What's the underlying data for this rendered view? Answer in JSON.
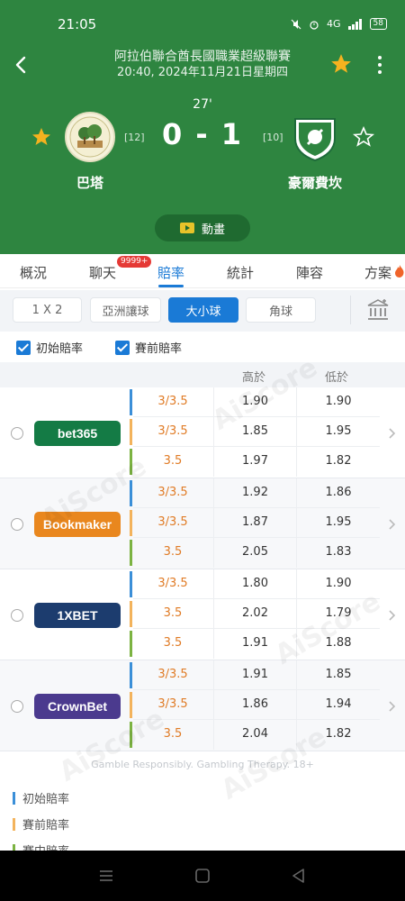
{
  "status_bar": {
    "time": "21:05",
    "network": "4G",
    "battery": "58"
  },
  "header": {
    "league": "阿拉伯聯合酋長國職業超級聯賽",
    "datetime": "20:40, 2024年11月21日星期四",
    "minute": "27'",
    "score": "0 - 1",
    "home": {
      "name": "巴塔",
      "rank": "[12]"
    },
    "away": {
      "name": "豪爾費坎",
      "rank": "[10]"
    },
    "animation_label": "動畫"
  },
  "tabs": [
    {
      "label": "概況"
    },
    {
      "label": "聊天"
    },
    {
      "label": "賠率"
    },
    {
      "label": "統計"
    },
    {
      "label": "陣容"
    },
    {
      "label": "方案"
    }
  ],
  "chat_badge": "9999+",
  "markets": [
    {
      "label": "1 X 2"
    },
    {
      "label": "亞洲讓球"
    },
    {
      "label": "大小球"
    },
    {
      "label": "角球"
    }
  ],
  "checkboxes": [
    {
      "label": "初始賠率"
    },
    {
      "label": "賽前賠率"
    }
  ],
  "table": {
    "headers": {
      "over": "高於",
      "under": "低於"
    },
    "bookmakers": [
      {
        "name": "bet365",
        "color": "#147b45",
        "rows": [
          {
            "line": "3/3.5",
            "over": "1.90",
            "under": "1.90"
          },
          {
            "line": "3/3.5",
            "over": "1.85",
            "under": "1.95"
          },
          {
            "line": "3.5",
            "over": "1.97",
            "under": "1.82"
          }
        ]
      },
      {
        "name": "Bookmaker",
        "color": "#e9871e",
        "rows": [
          {
            "line": "3/3.5",
            "over": "1.92",
            "under": "1.86"
          },
          {
            "line": "3/3.5",
            "over": "1.87",
            "under": "1.95"
          },
          {
            "line": "3.5",
            "over": "2.05",
            "under": "1.83"
          }
        ]
      },
      {
        "name": "1XBET",
        "color": "#1c3c6e",
        "rows": [
          {
            "line": "3/3.5",
            "over": "1.80",
            "under": "1.90"
          },
          {
            "line": "3.5",
            "over": "2.02",
            "under": "1.79"
          },
          {
            "line": "3.5",
            "over": "1.91",
            "under": "1.88"
          }
        ]
      },
      {
        "name": "CrownBet",
        "color": "#4b3a8e",
        "rows": [
          {
            "line": "3/3.5",
            "over": "1.91",
            "under": "1.85"
          },
          {
            "line": "3/3.5",
            "over": "1.86",
            "under": "1.94"
          },
          {
            "line": "3.5",
            "over": "2.04",
            "under": "1.82"
          }
        ]
      }
    ]
  },
  "footer_note": "Gamble Responsibly. Gambling Therapy. 18+",
  "legend": [
    {
      "label": "初始賠率",
      "color": "#3b8fd8"
    },
    {
      "label": "賽前賠率",
      "color": "#f3b35c"
    },
    {
      "label": "賽中賠率",
      "color": "#7cb342"
    }
  ],
  "watermark": "AiScore",
  "colors": {
    "header": "#2e8540",
    "accent": "#1a7ad6",
    "line_text": "#e07b25"
  }
}
